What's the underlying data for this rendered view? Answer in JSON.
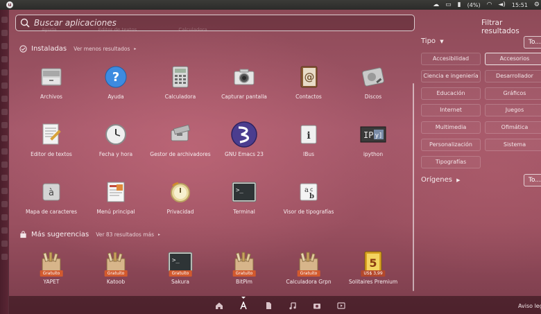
{
  "panel": {
    "battery_text": "(4%)",
    "clock": "15:51"
  },
  "search": {
    "placeholder": "Buscar aplicaciones"
  },
  "filters": {
    "title": "Filtrar resultados",
    "tipo_label": "Tipo",
    "tipo_all": "To...",
    "origenes_label": "Orígenes",
    "origenes_all": "To...",
    "categories": [
      "Accesibilidad",
      "Accesorios",
      "Ciencia e ingeniería",
      "Desarrollador",
      "Educación",
      "Gráficos",
      "Internet",
      "Juegos",
      "Multimedia",
      "Ofimática",
      "Personalización",
      "Sistema",
      "Tipografías"
    ],
    "active_category": "Accesorios"
  },
  "faded_row": [
    "Ayuda",
    "Editor de textos",
    "Calculadora"
  ],
  "installed": {
    "title": "Instaladas",
    "more": "Ver menos resultados",
    "apps": [
      {
        "label": "Archivos",
        "icon": "drawer-icon"
      },
      {
        "label": "Ayuda",
        "icon": "help-icon"
      },
      {
        "label": "Calculadora",
        "icon": "calculator-icon"
      },
      {
        "label": "Capturar pantalla",
        "icon": "camera-icon"
      },
      {
        "label": "Contactos",
        "icon": "contacts-icon"
      },
      {
        "label": "Discos",
        "icon": "disks-icon"
      },
      {
        "label": "Editor de textos",
        "icon": "text-editor-icon"
      },
      {
        "label": "Fecha y hora",
        "icon": "clock-icon"
      },
      {
        "label": "Gestor de archivadores",
        "icon": "archive-manager-icon"
      },
      {
        "label": "GNU Emacs 23",
        "icon": "emacs-icon"
      },
      {
        "label": "IBus",
        "icon": "ibus-icon"
      },
      {
        "label": "ipython",
        "icon": "ipython-icon"
      },
      {
        "label": "Mapa de caracteres",
        "icon": "character-map-icon"
      },
      {
        "label": "Menú principal",
        "icon": "main-menu-icon"
      },
      {
        "label": "Privacidad",
        "icon": "privacy-icon"
      },
      {
        "label": "Terminal",
        "icon": "terminal-icon"
      },
      {
        "label": "Visor de tipografías",
        "icon": "font-viewer-icon"
      }
    ]
  },
  "suggestions": {
    "title": "Más sugerencias",
    "more": "Ver 83 resultados más",
    "apps": [
      {
        "label": "YAPET",
        "badge": "Gratuito",
        "icon": "package-icon"
      },
      {
        "label": "Katoob",
        "badge": "Gratuito",
        "icon": "package-icon"
      },
      {
        "label": "Sakura",
        "badge": "Gratuito",
        "icon": "terminal-icon"
      },
      {
        "label": "BitPim",
        "badge": "Gratuito",
        "icon": "package-icon"
      },
      {
        "label": "Calculadora Grpn",
        "badge": "Gratuito",
        "icon": "package-icon"
      },
      {
        "label": "Solitaires Premium",
        "badge": "US$ 3,99",
        "icon": "solitaire-icon"
      }
    ]
  },
  "bottom": {
    "aviso": "Aviso leg"
  }
}
